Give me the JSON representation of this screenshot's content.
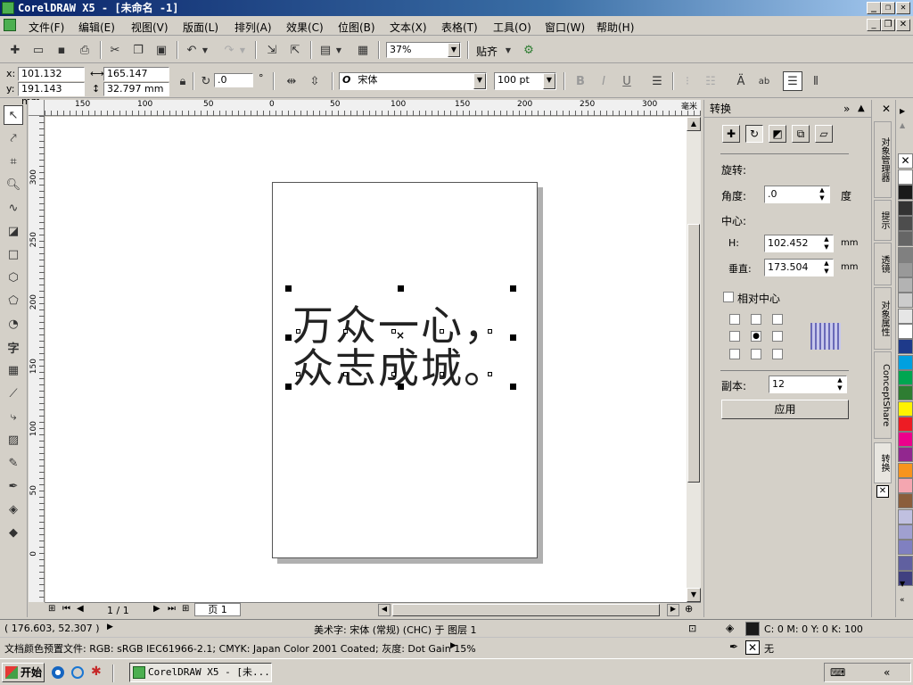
{
  "window": {
    "title": "CorelDRAW X5 - [未命名 -1]",
    "min": "_",
    "max": "❐",
    "close": "✕"
  },
  "menu": {
    "items": [
      "文件(F)",
      "编辑(E)",
      "视图(V)",
      "版面(L)",
      "排列(A)",
      "效果(C)",
      "位图(B)",
      "文本(X)",
      "表格(T)",
      "工具(O)",
      "窗口(W)",
      "帮助(H)"
    ]
  },
  "toolbar": {
    "zoom": "37%",
    "snap": "贴齐"
  },
  "property_bar": {
    "x_label": "x:",
    "x": "101.132 mm",
    "y_label": "y:",
    "y": "191.143 mm",
    "w_label": "⟷",
    "w": "165.147 mm",
    "h_label": "↕",
    "h": "32.797 mm",
    "angle": ".0",
    "deg": "°",
    "font_name": "宋体",
    "font_prefix": "O",
    "font_size": "100 pt",
    "bold": "B",
    "italic": "I",
    "underline": "U"
  },
  "ruler": {
    "h_ticks": [
      "150",
      "100",
      "50",
      "0",
      "50",
      "100",
      "150",
      "200",
      "250",
      "300"
    ],
    "units": "毫米",
    "v_ticks": [
      "300",
      "250",
      "200",
      "150",
      "100",
      "50",
      "0"
    ]
  },
  "artwork": {
    "line1": "万众一心，",
    "line2": "众志成城。"
  },
  "page_nav": {
    "count": "1 / 1",
    "tab": "页 1"
  },
  "docker": {
    "title": "转换",
    "rotate_heading": "旋转:",
    "angle_label": "角度:",
    "angle_value": ".0",
    "angle_unit": "度",
    "center_heading": "中心:",
    "h_label": "H:",
    "h_value": "102.452",
    "h_unit": "mm",
    "v_label": "垂直:",
    "v_value": "173.504",
    "v_unit": "mm",
    "relative_center": "相对中心",
    "copies_label": "副本:",
    "copies_value": "12",
    "apply": "应用"
  },
  "side_tabs": [
    "对象管理器",
    "提示",
    "透镜",
    "对象属性",
    "ConceptShare",
    "转换"
  ],
  "palette": {
    "colors": [
      "#ffffff",
      "#1a1a1a",
      "#333333",
      "#4d4d4d",
      "#666666",
      "#808080",
      "#999999",
      "#b3b3b3",
      "#cccccc",
      "#e6e6e6",
      "#ffffff",
      "#1e3a8a",
      "#00a0e0",
      "#00a651",
      "#2e7d32",
      "#fff200",
      "#ed1c24",
      "#ec008c",
      "#92278f",
      "#f7941d",
      "#f4a6b0",
      "#8b5e3c",
      "#c0c0e0",
      "#a0a0d0",
      "#8080c0",
      "#6060a0",
      "#404080"
    ]
  },
  "status": {
    "coords": "( 176.603, 52.307 )",
    "object": "美术字: 宋体 (常规) (CHC) 于 图层 1",
    "fill": "C: 0 M: 0 Y: 0 K: 100",
    "outline": "无",
    "profile": "文档颜色预置文件: RGB: sRGB IEC61966-2.1; CMYK: Japan Color 2001 Coated; 灰度: Dot Gain 15%"
  },
  "taskbar": {
    "start": "开始",
    "task": "CorelDRAW X5 - [未...",
    "tray": "«"
  }
}
